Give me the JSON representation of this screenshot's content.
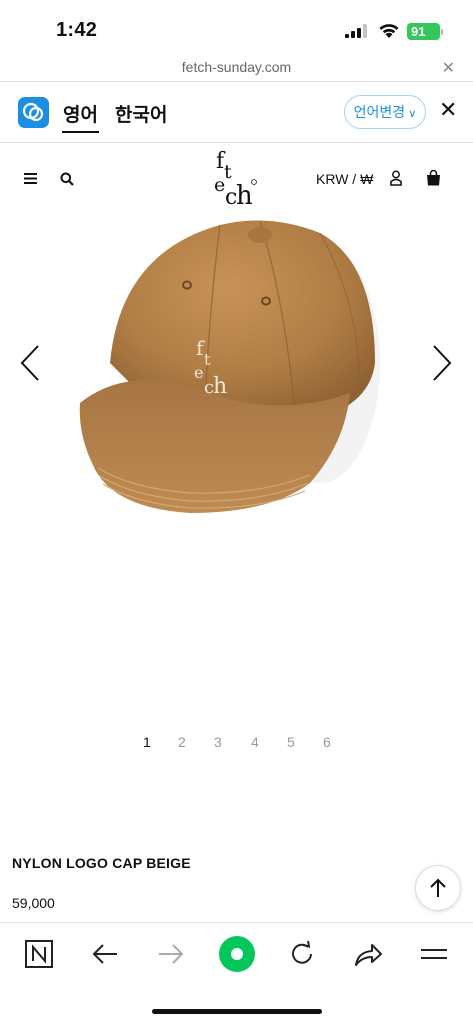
{
  "status_bar": {
    "time": "1:42",
    "battery": "91"
  },
  "browser": {
    "url": "fetch-sunday.com"
  },
  "translate_bar": {
    "source_lang": "영어",
    "target_lang": "한국어",
    "change_label": "언어변경",
    "accent_color": "#1a8fe6"
  },
  "site_header": {
    "currency": "KRW / ₩"
  },
  "product": {
    "name": "NYLON LOGO CAP BEIGE",
    "price": "59,000",
    "image_count": 6,
    "current_image": 1,
    "pages": [
      "1",
      "2",
      "3",
      "4",
      "5",
      "6"
    ],
    "cap_color": "#b07d45"
  },
  "icons": {
    "header": [
      "menu-icon",
      "search-icon",
      "user-icon",
      "bag-icon"
    ],
    "toolbar": [
      "naver-home-icon",
      "back-icon",
      "forward-icon",
      "green-dot-icon",
      "reload-icon",
      "share-icon",
      "menu-icon"
    ]
  }
}
